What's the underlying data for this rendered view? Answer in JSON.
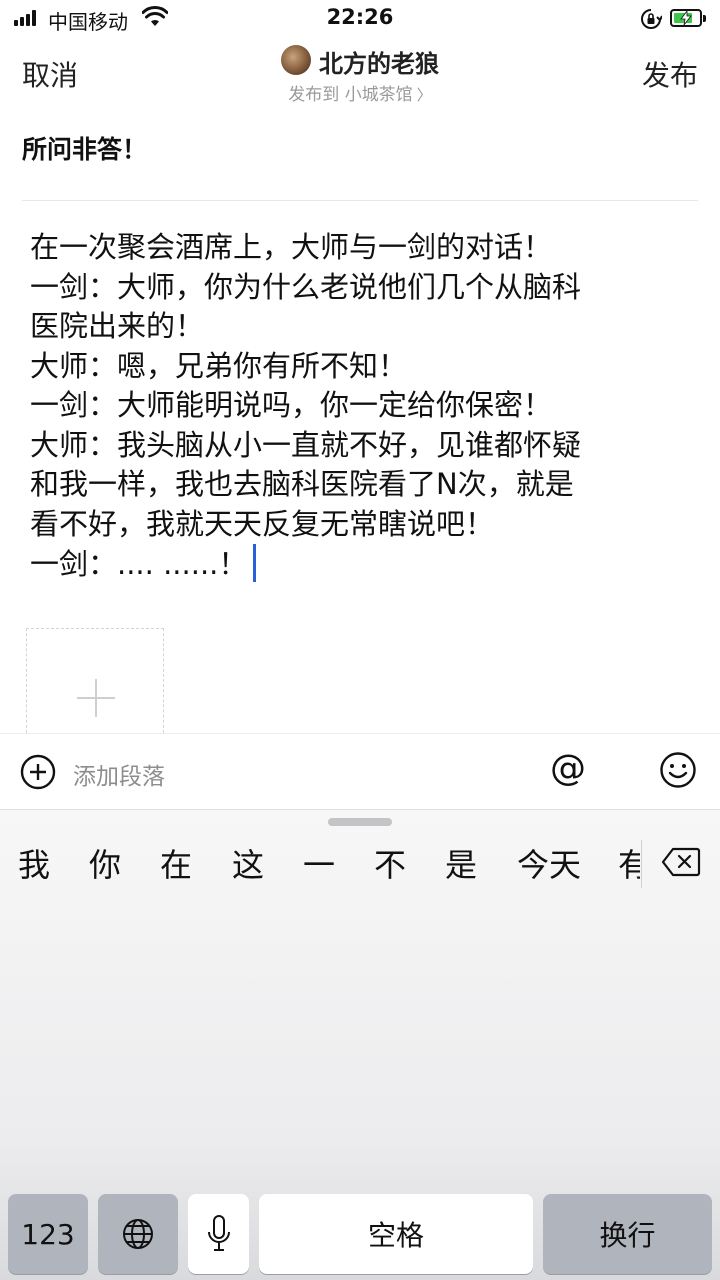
{
  "status_bar": {
    "carrier": "中国移动",
    "time": "22:26"
  },
  "header": {
    "cancel_label": "取消",
    "publish_label": "发布",
    "author_name": "北方的老狼",
    "publish_to_prefix": "发布到",
    "publish_to_target": "小城茶馆",
    "chevron": "〉"
  },
  "post": {
    "title": "所问非答！",
    "body_lines": [
      "在一次聚会酒席上，大师与一剑的对话！",
      "一剑：大师，你为什么老说他们几个从脑科",
      "医院出来的！",
      "大师：嗯，兄弟你有所不知！",
      "一剑：大师能明说吗，你一定给你保密！",
      "大师：我头脑从小一直就不好，见谁都怀疑",
      "和我一样，我也去脑科医院看了N次，就是",
      "看不好，我就天天反复无常瞎说吧！",
      "一剑：....  ......！"
    ]
  },
  "toolbar": {
    "add_paragraph_label": "添加段落",
    "mention_symbol": "@"
  },
  "keyboard": {
    "candidates": [
      "我",
      "你",
      "在",
      "这",
      "一",
      "不",
      "是",
      "今天",
      "有"
    ],
    "keys": {
      "numbers": "123",
      "space": "空格",
      "return": "换行"
    }
  },
  "icons": {
    "signal": "signal-icon",
    "wifi": "wifi-icon",
    "lock": "rotation-lock-icon",
    "battery": "battery-charging-icon",
    "add_paragraph": "plus-circle-icon",
    "mention": "at-icon",
    "emoji": "smile-icon",
    "add_image": "plus-icon",
    "backspace": "backspace-icon",
    "globe": "globe-icon",
    "mic": "microphone-icon"
  }
}
